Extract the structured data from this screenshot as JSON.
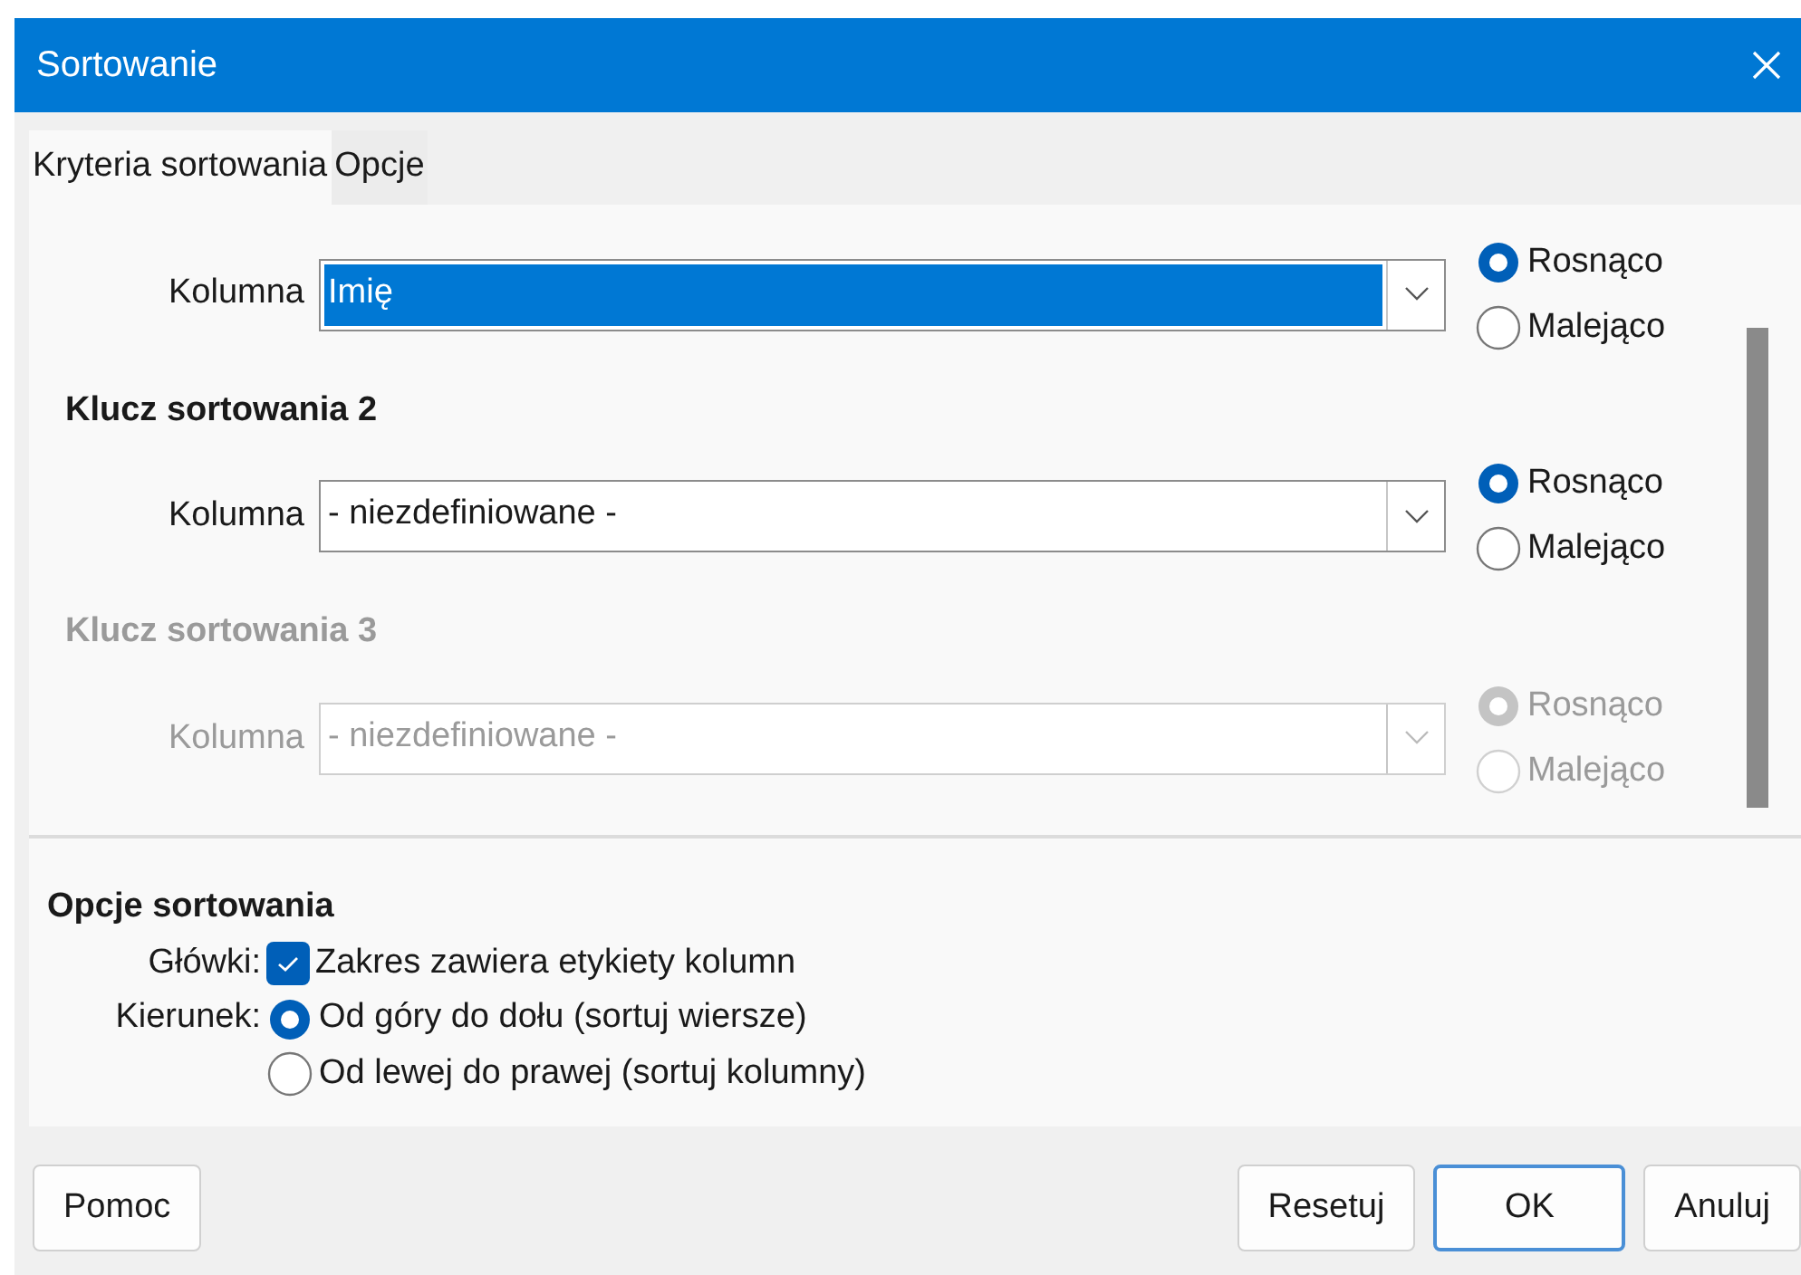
{
  "window": {
    "title": "Sortowanie"
  },
  "tabs": [
    {
      "label": "Kryteria sortowania",
      "selected": true
    },
    {
      "label": "Opcje",
      "selected": false
    }
  ],
  "sort_keys": [
    {
      "column_label": "Kolumna",
      "value": "Imię",
      "selected": true,
      "disabled": false,
      "order": [
        {
          "label": "Rosnąco",
          "selected": true
        },
        {
          "label": "Malejąco",
          "selected": false
        }
      ]
    },
    {
      "heading": "Klucz sortowania 2",
      "column_label": "Kolumna",
      "value": "- niezdefiniowane -",
      "selected": false,
      "disabled": false,
      "order": [
        {
          "label": "Rosnąco",
          "selected": true
        },
        {
          "label": "Malejąco",
          "selected": false
        }
      ]
    },
    {
      "heading": "Klucz sortowania 3",
      "column_label": "Kolumna",
      "value": "- niezdefiniowane -",
      "selected": false,
      "disabled": true,
      "order": [
        {
          "label": "Rosnąco",
          "selected": true
        },
        {
          "label": "Malejąco",
          "selected": false
        }
      ]
    }
  ],
  "sort_options": {
    "heading": "Opcje sortowania",
    "headers": {
      "label": "Główki:",
      "checkbox": {
        "label": "Zakres zawiera etykiety kolumn",
        "checked": true
      }
    },
    "direction": {
      "label": "Kierunek:",
      "options": [
        {
          "label": "Od góry do dołu (sortuj wiersze)",
          "selected": true
        },
        {
          "label": "Od lewej do prawej (sortuj kolumny)",
          "selected": false
        }
      ]
    }
  },
  "buttons_left": [
    {
      "label": "Pomoc",
      "default": false
    }
  ],
  "buttons_right": [
    {
      "label": "Resetuj",
      "default": false
    },
    {
      "label": "OK",
      "default": true
    },
    {
      "label": "Anuluj",
      "default": false
    }
  ]
}
